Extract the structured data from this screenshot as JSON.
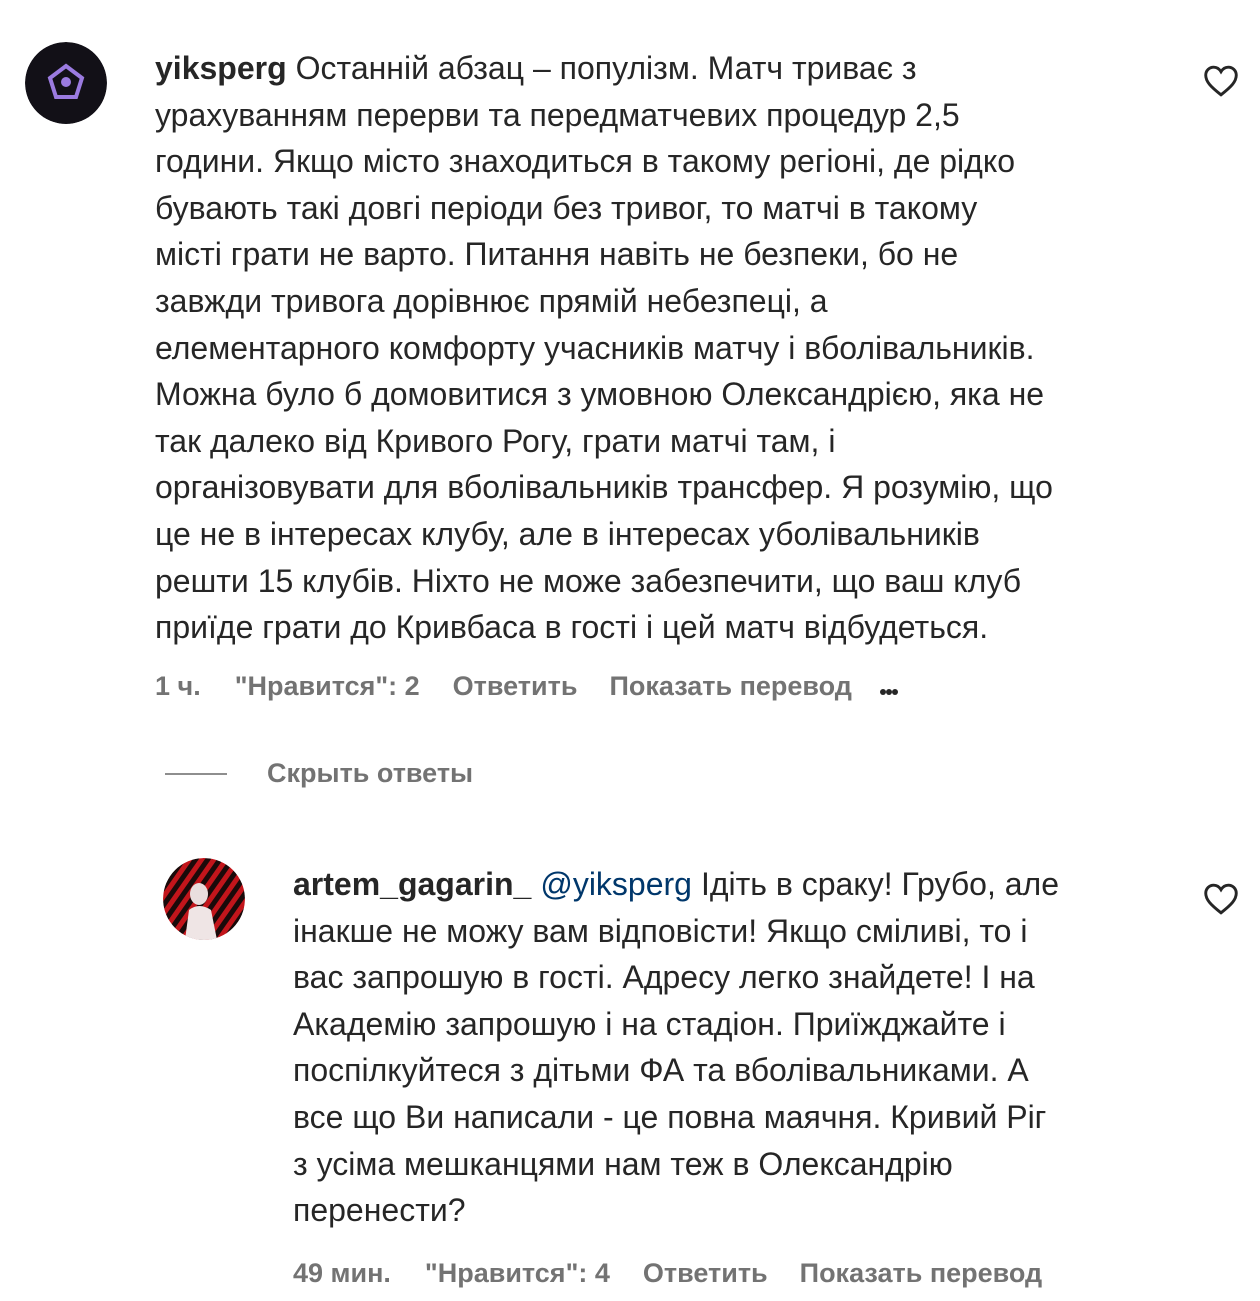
{
  "comments": [
    {
      "username": "yiksperg",
      "text_lines": [
        "Останній абзац – популізм. Матч триває з",
        "урахуванням перерви та передматчевих процедур 2,5",
        "години. Якщо місто знаходиться в такому регіоні, де рідко",
        "бувають такі довгі періоди без тривог, то матчі в такому",
        "місті грати не варто. Питання навіть не безпеки, бо не",
        "завжди тривога дорівнює прямій небезпеці, а",
        "елементарного комфорту учасників матчу і вболівальників.",
        "Можна було б домовитися з умовною Олександрією, яка не",
        "так далеко від Кривого Рогу, грати матчі там, і",
        "організовувати для вболівальників трансфер. Я розумію, що",
        "це не в інтересах клубу, але в інтересах уболівальників",
        "решти 15 клубів. Ніхто не може забезпечити, що ваш клуб",
        "приїде грати до Кривбаса в гості і цей матч відбудеться."
      ],
      "time": "1 ч.",
      "likes": "\"Нравится\": 2",
      "reply": "Ответить",
      "translate": "Показать перевод",
      "avatar_icon": "pentagon-logo-icon"
    },
    {
      "username": "artem_gagarin_",
      "mention": "@yiksperg",
      "text_lines": [
        "Ідіть в сраку! Грубо, але",
        "інакше не можу вам відповісти! Якщо сміливі, то і",
        "вас запрошую в гості. Адресу легко знайдете! І на",
        "Академію запрошую і на стадіон. Приїжджайте і",
        "поспілкуйтеся з дітьми ФА та вболівальниками. А",
        "все що Ви написали - це повна маячня. Кривий Ріг",
        "з усіма мешканцями нам теж в Олександрію",
        "перенести?"
      ],
      "time": "49 мин.",
      "likes": "\"Нравится\": 4",
      "reply": "Ответить",
      "translate": "Показать перевод",
      "avatar_icon": "red-black-photo-avatar"
    }
  ],
  "hide_replies": "Скрыть ответы",
  "colors": {
    "text": "#262626",
    "muted": "#737373",
    "mention": "#00376b"
  }
}
